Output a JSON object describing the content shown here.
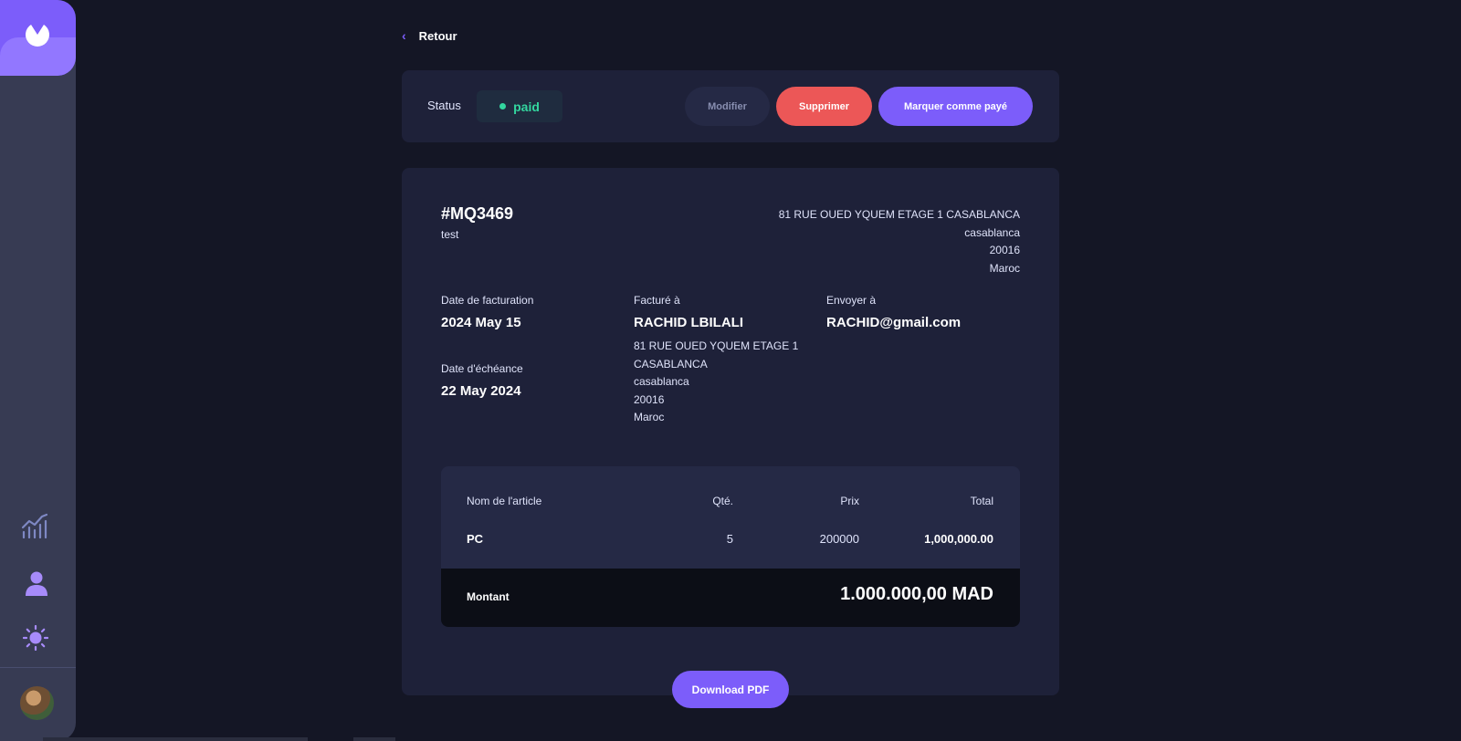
{
  "sidebar": {
    "logo_icon": "app-logo-icon",
    "nav_icons": [
      "chart-icon",
      "user-icon",
      "theme-sun-icon"
    ],
    "avatar": "user-avatar"
  },
  "back_label": "Retour",
  "status_bar": {
    "label": "Status",
    "status": "paid",
    "status_color": "#33d69f",
    "edit_label": "Modifier",
    "delete_label": "Supprimer",
    "mark_paid_label": "Marquer comme payé"
  },
  "invoice": {
    "id": "#MQ3469",
    "description": "test",
    "sender_address": {
      "street": "81 RUE OUED YQUEM ETAGE 1 CASABLANCA",
      "city": "casablanca",
      "postcode": "20016",
      "country": "Maroc"
    },
    "invoice_date_label": "Date de facturation",
    "invoice_date": "2024 May 15",
    "due_date_label": "Date d'échéance",
    "due_date": "22 May 2024",
    "bill_to_label": "Facturé à",
    "client_name": "RACHID LBILALI",
    "client_address": {
      "street": "81 RUE OUED YQUEM ETAGE 1 CASABLANCA",
      "city": "casablanca",
      "postcode": "20016",
      "country": "Maroc"
    },
    "send_to_label": "Envoyer à",
    "client_email": "RACHID@gmail.com"
  },
  "items_table": {
    "headers": [
      "Nom de l'article",
      "Qté.",
      "Prix",
      "Total"
    ],
    "rows": [
      {
        "name": "PC",
        "qty": "5",
        "price": "200000",
        "total": "1,000,000.00"
      }
    ],
    "amount_label": "Montant",
    "amount": "1.000.000,00 MAD"
  },
  "download_label": "Download PDF",
  "colors": {
    "accent": "#7c5dfa",
    "danger": "#ec5757",
    "background": "#141625",
    "card": "#1e2139"
  }
}
